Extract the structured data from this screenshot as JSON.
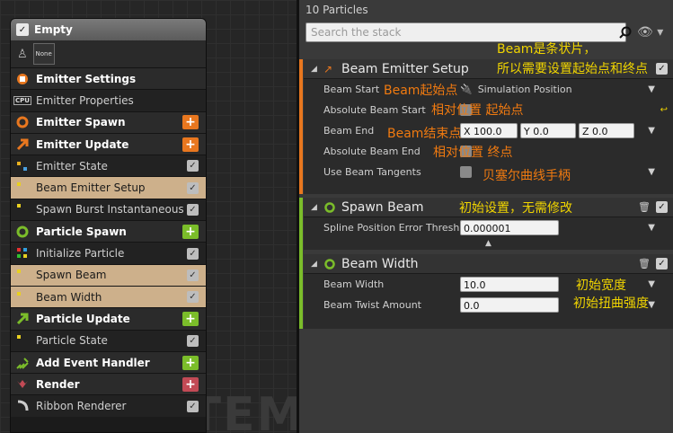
{
  "graph": {
    "watermark": "SYSTEM",
    "node": {
      "title": "Empty",
      "thumbnail_label": "None",
      "rows": [
        {
          "label": "Emitter Settings",
          "kind": "header",
          "icon": "emitter-settings-icon",
          "color": "#e8771f"
        },
        {
          "label": "Emitter Properties",
          "kind": "module",
          "icon": "cpu-icon"
        },
        {
          "label": "Emitter Spawn",
          "kind": "header",
          "icon": "emitter-spawn-icon",
          "color": "#e8771f",
          "action": "+"
        },
        {
          "label": "Emitter Update",
          "kind": "header",
          "icon": "emitter-update-icon",
          "color": "#e8771f",
          "action": "+"
        },
        {
          "label": "Emitter State",
          "kind": "module",
          "icon": "state-icon",
          "check": true
        },
        {
          "label": "Beam Emitter Setup",
          "kind": "selected",
          "icon": "dot-icon",
          "check": true
        },
        {
          "label": "Spawn Burst Instantaneous",
          "kind": "module",
          "icon": "dot-icon",
          "check": true
        },
        {
          "label": "Particle Spawn",
          "kind": "header",
          "icon": "particle-spawn-icon",
          "color": "#7bbd2a",
          "action": "+"
        },
        {
          "label": "Initialize Particle",
          "kind": "module",
          "icon": "grid-icon",
          "check": true
        },
        {
          "label": "Spawn Beam",
          "kind": "selected",
          "icon": "dot-icon",
          "check": true
        },
        {
          "label": "Beam Width",
          "kind": "selected",
          "icon": "dot-icon",
          "check": true
        },
        {
          "label": "Particle Update",
          "kind": "header",
          "icon": "particle-update-icon",
          "color": "#7bbd2a",
          "action": "+"
        },
        {
          "label": "Particle State",
          "kind": "module",
          "icon": "dot-icon",
          "check": true
        },
        {
          "label": "Add Event Handler",
          "kind": "header",
          "icon": "event-handler-icon",
          "color": "#7bbd2a",
          "action": "+"
        },
        {
          "label": "Render",
          "kind": "header",
          "icon": "render-icon",
          "color": "#c24a55",
          "action": "+"
        },
        {
          "label": "Ribbon Renderer",
          "kind": "module",
          "icon": "ribbon-icon",
          "check": true
        }
      ]
    }
  },
  "panel": {
    "title": "10 Particles",
    "search_placeholder": "Search the stack",
    "modules": [
      {
        "title": "Beam Emitter Setup",
        "params": [
          {
            "label": "Beam Start",
            "value": "Simulation Position",
            "type": "dropdown"
          },
          {
            "label": "Absolute Beam Start",
            "value": "",
            "type": "checkbox"
          },
          {
            "label": "Beam End",
            "x": "X 100.0",
            "y": "Y 0.0",
            "z": "Z 0.0",
            "type": "vector"
          },
          {
            "label": "Absolute Beam End",
            "value": "",
            "type": "checkbox"
          },
          {
            "label": "Use Beam Tangents",
            "value": "",
            "type": "checkbox"
          }
        ]
      },
      {
        "title": "Spawn Beam",
        "params": [
          {
            "label": "Spline Position Error Thresh",
            "value": "0.000001",
            "type": "number"
          }
        ]
      },
      {
        "title": "Beam Width",
        "params": [
          {
            "label": "Beam Width",
            "value": "10.0",
            "type": "number"
          },
          {
            "label": "Beam Twist Amount",
            "value": "0.0",
            "type": "number"
          }
        ]
      }
    ],
    "annotations": {
      "note_top_1": "Beam是条状片，",
      "note_top_2": "所以需要设置起始点和终点",
      "beam_start": "Beam起始点",
      "abs_start": "相对位置 起始点",
      "beam_end": "Beam结束点",
      "abs_end": "相对位置 终点",
      "tangents": "贝塞尔曲线手柄",
      "spawn_beam": "初始设置，无需修改",
      "beam_width": "初始宽度",
      "twist": "初始扭曲强度"
    }
  },
  "colors": {
    "orange": "#e8771f",
    "green": "#7bbd2a",
    "red": "#c24a55",
    "selected": "#cdb08b"
  }
}
